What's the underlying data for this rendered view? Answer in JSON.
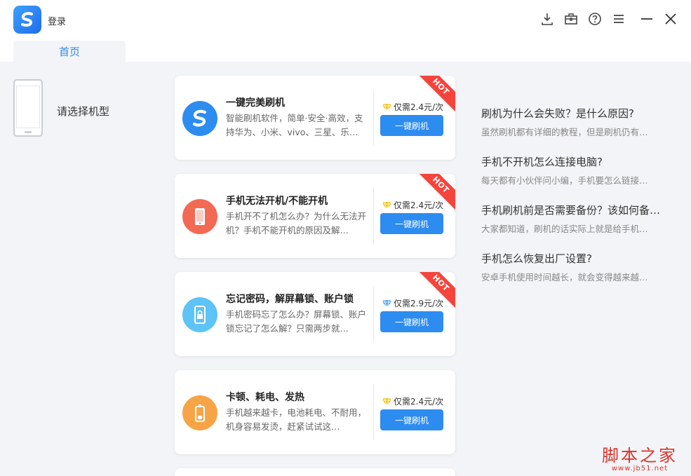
{
  "header": {
    "login_label": "登录",
    "tab_home": "首页",
    "controls": [
      "download-icon",
      "toolbox-icon",
      "help-icon",
      "menu-icon",
      "minimize-icon",
      "close-icon"
    ]
  },
  "left_panel": {
    "select_model": "请选择机型"
  },
  "cards": [
    {
      "title": "一键完美刷机",
      "desc": "智能刷机软件，简单·安全·高效，支持华为、小米、vivo、三星、乐…",
      "price": "仅需2.4元/次",
      "button": "一键刷机",
      "badge": "HOT",
      "icon": "flash-logo-icon",
      "icon_color": "#2d8cf0",
      "diamond_color": "#f5c518"
    },
    {
      "title": "手机无法开机/不能开机",
      "desc": "手机开不了机怎么办？为什么无法开机？手机不能开机的原因及解…",
      "price": "仅需2.4元/次",
      "button": "一键刷机",
      "badge": "HOT",
      "icon": "phone-icon",
      "icon_color": "#f26a54",
      "diamond_color": "#f5c518"
    },
    {
      "title": "忘记密码，解屏幕锁、账户锁",
      "desc": "手机密码忘了怎么办？屏幕锁、账户锁忘记了怎么解？只需两步就…",
      "price": "仅需2.9元/次",
      "button": "一键刷机",
      "badge": "HOT",
      "icon": "lock-phone-icon",
      "icon_color": "#5ec3f5",
      "diamond_color": "#5aa9e6"
    },
    {
      "title": "卡顿、耗电、发热",
      "desc": "手机越来越卡，电池耗电、不耐用，机身容易发烫，赶紧试试这…",
      "price": "仅需2.4元/次",
      "button": "一键刷机",
      "badge": "",
      "icon": "battery-icon",
      "icon_color": "#f7a447",
      "diamond_color": "#f5c518"
    }
  ],
  "articles": [
    {
      "title": "刷机为什么会失败？是什么原因?",
      "snippet": "虽然刷机都有详细的教程，但是刷机仍有…"
    },
    {
      "title": "手机不开机怎么连接电脑?",
      "snippet": "每天都有小伙伴问小编，手机要怎么链接…"
    },
    {
      "title": "手机刷机前是否需要备份？该如何备…",
      "snippet": "大家都知道，刷机的话实际上就是给手机…"
    },
    {
      "title": "手机怎么恢复出厂设置?",
      "snippet": "安卓手机使用时间越长，就会变得越来越…"
    }
  ],
  "watermark": {
    "big": "脚本之家",
    "small": "www.jb51.net"
  },
  "colors": {
    "accent": "#2d8cf0",
    "hot": "#f5443c",
    "background": "#f3f4f7"
  }
}
